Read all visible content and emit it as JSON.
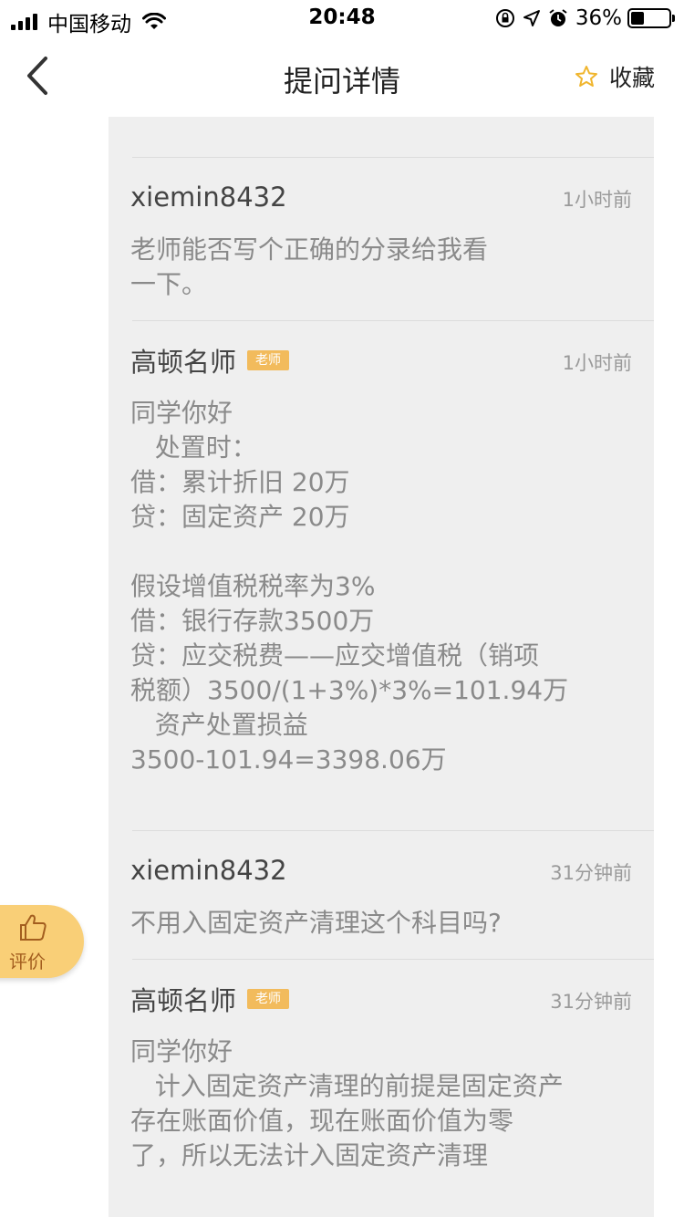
{
  "status_bar": {
    "carrier": "中国移动",
    "time": "20:48",
    "battery": "36%",
    "battery_level": 0.36
  },
  "nav": {
    "title": "提问详情",
    "favorite_label": "收藏"
  },
  "rate_button": {
    "label": "评价"
  },
  "messages": [
    {
      "author": "xiemin8432",
      "badge": "",
      "time": "1小时前",
      "text": "老师能否写个正确的分录给我看\n一下。"
    },
    {
      "author": "高顿名师",
      "badge": "老师",
      "time": "1小时前",
      "text": "同学你好\n   处置时：\n借：累计折旧 20万\n贷：固定资产 20万\n\n假设增值税税率为3%\n借：银行存款3500万\n贷：应交税费——应交增值税（销项\n税额）3500/(1+3%)*3%=101.94万\n   资产处置损益\n3500-101.94=3398.06万\n\n"
    },
    {
      "author": "xiemin8432",
      "badge": "",
      "time": "31分钟前",
      "text": "不用入固定资产清理这个科目吗?"
    },
    {
      "author": "高顿名师",
      "badge": "老师",
      "time": "31分钟前",
      "text": "同学你好\n   计入固定资产清理的前提是固定资产\n存在账面价值，现在账面价值为零\n了，所以无法计入固定资产清理"
    }
  ]
}
